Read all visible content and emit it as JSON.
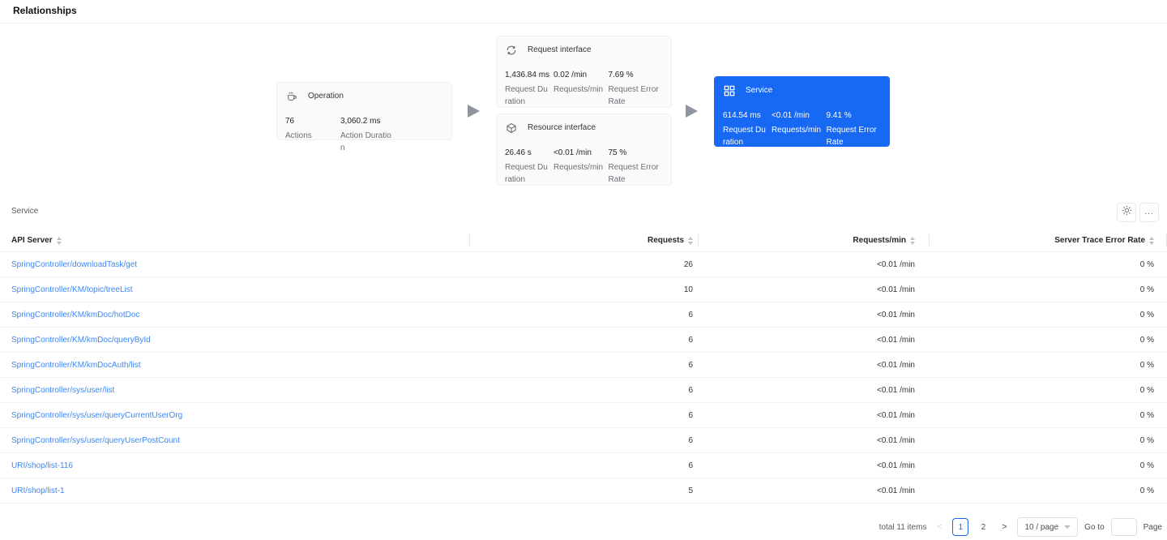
{
  "page": {
    "title": "Relationships"
  },
  "diagram": {
    "nodes": {
      "operation": {
        "icon": "coffee-icon",
        "title": "Operation",
        "metrics": [
          {
            "value": "76",
            "label": "Actions"
          },
          {
            "value": "3,060.2 ms",
            "label": "Action Duration"
          }
        ]
      },
      "request_interface": {
        "icon": "sync-arrows-icon",
        "title": "Request interface",
        "metrics": [
          {
            "value": "1,436.84 ms",
            "label": "Request Duration"
          },
          {
            "value": "0.02 /min",
            "label": "Requests/min"
          },
          {
            "value": "7.69 %",
            "label": "Request Error Rate"
          }
        ]
      },
      "resource_interface": {
        "icon": "cube-icon",
        "title": "Resource interface",
        "metrics": [
          {
            "value": "26.46 s",
            "label": "Request Duration"
          },
          {
            "value": "<0.01 /min",
            "label": "Requests/min"
          },
          {
            "value": "75 %",
            "label": "Request Error Rate"
          }
        ]
      },
      "service": {
        "icon": "grid-icon",
        "title": "Service",
        "selected": true,
        "metrics": [
          {
            "value": "614.54 ms",
            "label": "Request Duration"
          },
          {
            "value": "<0.01 /min",
            "label": "Requests/min"
          },
          {
            "value": "9.41 %",
            "label": "Request Error Rate"
          }
        ]
      }
    }
  },
  "section": {
    "title": "Service",
    "toolbar": {
      "settings_icon": "gear-icon",
      "more_label": "..."
    }
  },
  "table": {
    "headers": [
      {
        "label": "API Server"
      },
      {
        "label": "Requests"
      },
      {
        "label": "Requests/min"
      },
      {
        "label": "Server Trace Error Rate"
      }
    ],
    "rows": [
      {
        "api": "SpringController/downloadTask/get",
        "requests": "26",
        "requests_per_min": "<0.01 /min",
        "error_rate": "0 %"
      },
      {
        "api": "SpringController/KM/topic/treeList",
        "requests": "10",
        "requests_per_min": "<0.01 /min",
        "error_rate": "0 %"
      },
      {
        "api": "SpringController/KM/kmDoc/hotDoc",
        "requests": "6",
        "requests_per_min": "<0.01 /min",
        "error_rate": "0 %"
      },
      {
        "api": "SpringController/KM/kmDoc/queryById",
        "requests": "6",
        "requests_per_min": "<0.01 /min",
        "error_rate": "0 %"
      },
      {
        "api": "SpringController/KM/kmDocAuth/list",
        "requests": "6",
        "requests_per_min": "<0.01 /min",
        "error_rate": "0 %"
      },
      {
        "api": "SpringController/sys/user/list",
        "requests": "6",
        "requests_per_min": "<0.01 /min",
        "error_rate": "0 %"
      },
      {
        "api": "SpringController/sys/user/queryCurrentUserOrg",
        "requests": "6",
        "requests_per_min": "<0.01 /min",
        "error_rate": "0 %"
      },
      {
        "api": "SpringController/sys/user/queryUserPostCount",
        "requests": "6",
        "requests_per_min": "<0.01 /min",
        "error_rate": "0 %"
      },
      {
        "api": "URI/shop/list-116",
        "requests": "6",
        "requests_per_min": "<0.01 /min",
        "error_rate": "0 %"
      },
      {
        "api": "URI/shop/list-1",
        "requests": "5",
        "requests_per_min": "<0.01 /min",
        "error_rate": "0 %"
      }
    ]
  },
  "pagination": {
    "total": "total 11 items",
    "prev": "<",
    "next": ">",
    "pages": [
      "1",
      "2"
    ],
    "active_page": "1",
    "page_size": "10 / page",
    "goto_label": "Go to",
    "goto_value": "",
    "page_label": "Page"
  },
  "colors": {
    "accent_blue": "#1768f2",
    "link_blue": "#3d87f5",
    "card_bg": "#fafafa"
  }
}
